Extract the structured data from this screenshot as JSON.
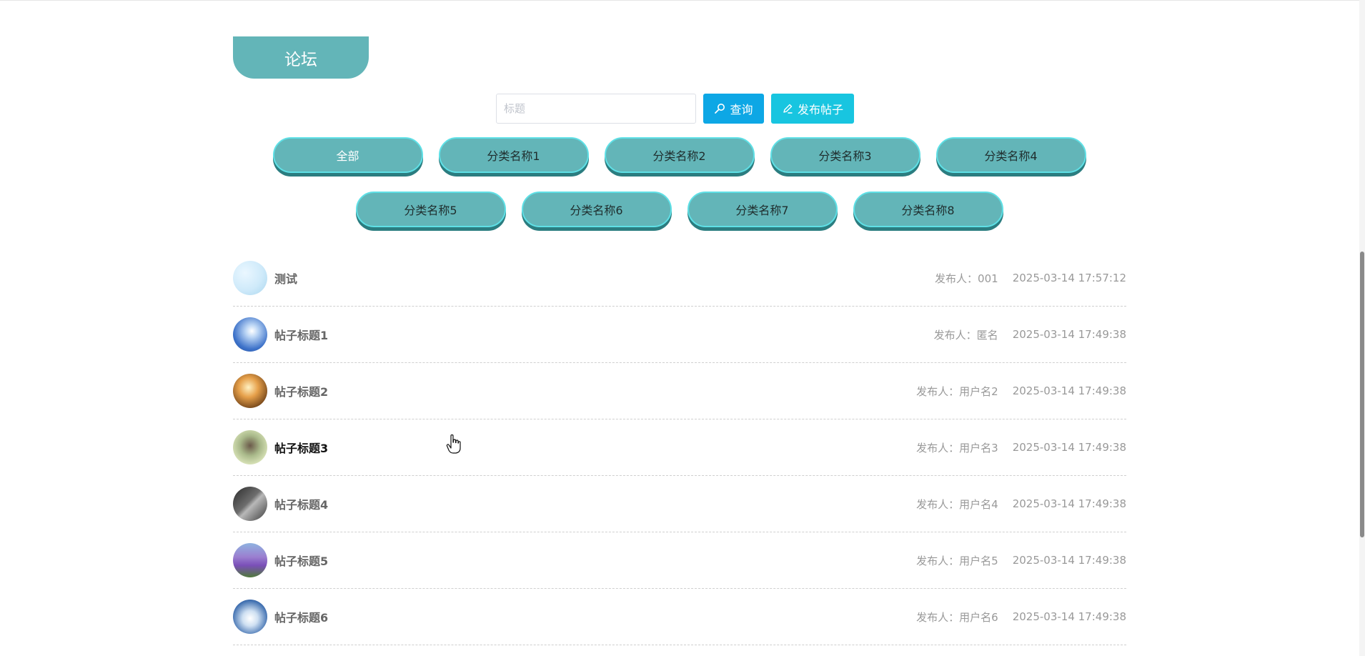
{
  "header": {
    "title": "论坛"
  },
  "search": {
    "placeholder": "标题",
    "value": "",
    "query_label": "查询",
    "post_label": "发布帖子"
  },
  "categories": {
    "row1": [
      "全部",
      "分类名称1",
      "分类名称2",
      "分类名称3",
      "分类名称4"
    ],
    "row2": [
      "分类名称5",
      "分类名称6",
      "分类名称7",
      "分类名称8"
    ]
  },
  "posts": [
    {
      "title": "测试",
      "author": "发布人：001",
      "time": "2025-03-14 17:57:12",
      "avatar": "light-blue-sky"
    },
    {
      "title": "帖子标题1",
      "author": "发布人：匿名",
      "time": "2025-03-14 17:49:38",
      "avatar": "blue-sky-sun"
    },
    {
      "title": "帖子标题2",
      "author": "发布人：用户名2",
      "time": "2025-03-14 17:49:38",
      "avatar": "sunset-runner"
    },
    {
      "title": "帖子标题3",
      "author": "发布人：用户名3",
      "time": "2025-03-14 17:49:38",
      "avatar": "field-figure"
    },
    {
      "title": "帖子标题4",
      "author": "发布人：用户名4",
      "time": "2025-03-14 17:49:38",
      "avatar": "dark-building"
    },
    {
      "title": "帖子标题5",
      "author": "发布人：用户名5",
      "time": "2025-03-14 17:49:38",
      "avatar": "purple-flowers"
    },
    {
      "title": "帖子标题6",
      "author": "发布人：用户名6",
      "time": "2025-03-14 17:49:38",
      "avatar": "sky-clouds"
    }
  ],
  "colors": {
    "accent": "#63b5b8",
    "query_button": "#0da7e5",
    "post_button": "#18c5e0"
  }
}
